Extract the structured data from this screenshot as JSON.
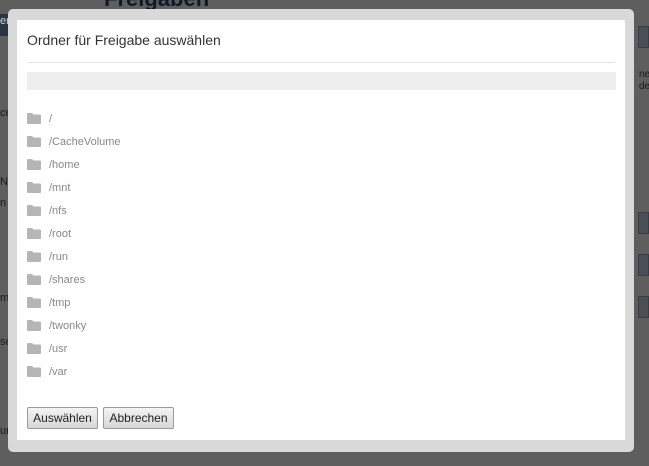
{
  "background": {
    "page_title": "Freigaben",
    "fragments": [
      "er",
      "ce",
      "Na",
      "n",
      "m",
      "se",
      "ur",
      "ner",
      "de"
    ]
  },
  "dialog": {
    "title": "Ordner für Freigabe auswählen",
    "path_value": "",
    "folders": [
      {
        "label": "/",
        "icon": "folder-icon"
      },
      {
        "label": "/CacheVolume",
        "icon": "folder-icon"
      },
      {
        "label": "/home",
        "icon": "folder-icon"
      },
      {
        "label": "/mnt",
        "icon": "folder-icon"
      },
      {
        "label": "/nfs",
        "icon": "folder-icon"
      },
      {
        "label": "/root",
        "icon": "folder-icon"
      },
      {
        "label": "/run",
        "icon": "folder-icon"
      },
      {
        "label": "/shares",
        "icon": "folder-icon"
      },
      {
        "label": "/tmp",
        "icon": "folder-icon"
      },
      {
        "label": "/twonky",
        "icon": "folder-icon"
      },
      {
        "label": "/usr",
        "icon": "folder-icon"
      },
      {
        "label": "/var",
        "icon": "folder-icon"
      }
    ],
    "buttons": {
      "select_label": "Auswählen",
      "cancel_label": "Abbrechen"
    }
  },
  "colors": {
    "overlay": "#5e5e5e",
    "folder_icon": "#b5b5b5",
    "folder_label": "#888888"
  }
}
